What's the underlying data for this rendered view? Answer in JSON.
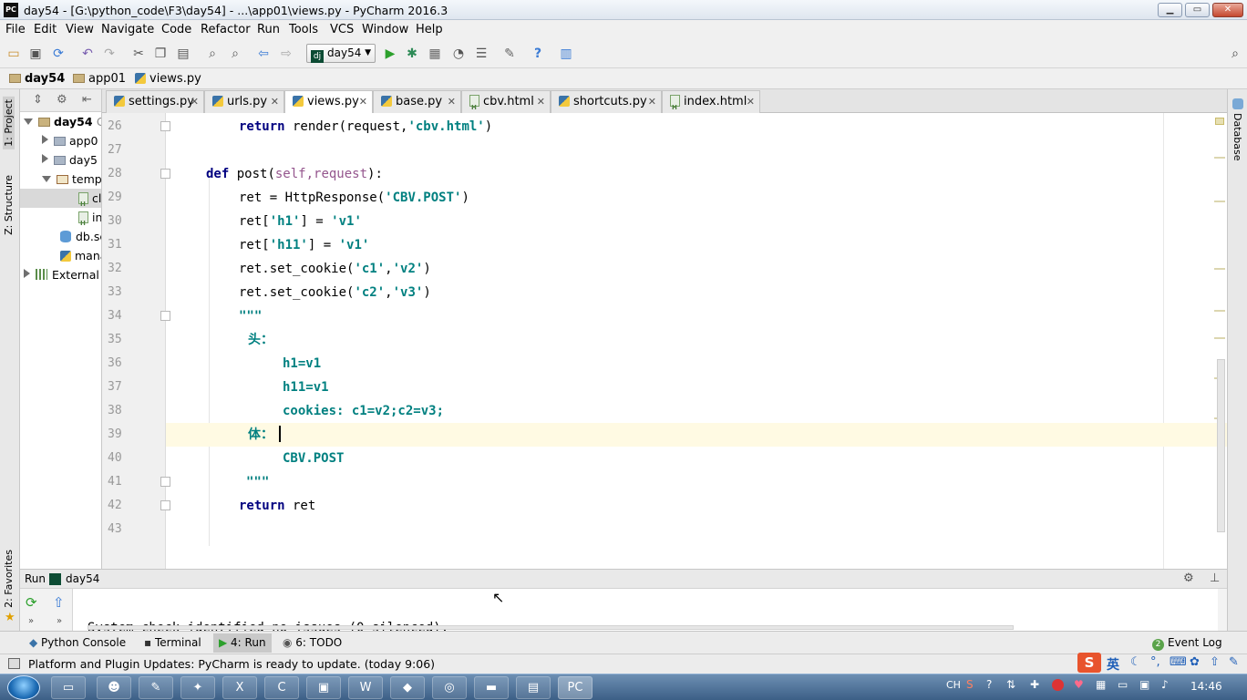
{
  "window": {
    "app_icon_label": "PC",
    "title": "day54 - [G:\\python_code\\F3\\day54] - ...\\app01\\views.py - PyCharm 2016.3",
    "minimize": "▁",
    "maximize": "▭",
    "close": "✕"
  },
  "menu": [
    "File",
    "Edit",
    "View",
    "Navigate",
    "Code",
    "Refactor",
    "Run",
    "Tools",
    "VCS",
    "Window",
    "Help"
  ],
  "toolbar": {
    "run_config": "day54",
    "run_config_icon": "dj"
  },
  "breadcrumb": [
    "day54",
    "app01",
    "views.py"
  ],
  "left_tool_tabs": {
    "project": "1: Project",
    "structure": "Z: Structure",
    "favorites": "2: Favorites"
  },
  "right_tool_tabs": {
    "database": "Database"
  },
  "project_tree": [
    {
      "label": "day54",
      "suffix": "G",
      "expanded": true
    },
    {
      "label": "app0",
      "collapsed": true
    },
    {
      "label": "day5",
      "collapsed": true
    },
    {
      "label": "temp",
      "expanded": true
    },
    {
      "label": "cl",
      "selected": true
    },
    {
      "label": "in"
    },
    {
      "label": "db.sc"
    },
    {
      "label": "mana"
    },
    {
      "label": "External",
      "collapsed": true
    }
  ],
  "tabs": [
    {
      "label": "settings.py",
      "icon": "python-file-icon"
    },
    {
      "label": "urls.py",
      "icon": "python-file-icon"
    },
    {
      "label": "views.py",
      "icon": "python-file-icon",
      "active": true
    },
    {
      "label": "base.py",
      "icon": "python-file-icon"
    },
    {
      "label": "cbv.html",
      "icon": "html-file-icon"
    },
    {
      "label": "shortcuts.py",
      "icon": "python-file-icon"
    },
    {
      "label": "index.html",
      "icon": "html-file-icon"
    }
  ],
  "tab_close": "✕",
  "editor": {
    "line_numbers": [
      "26",
      "27",
      "28",
      "29",
      "30",
      "31",
      "32",
      "33",
      "34",
      "35",
      "36",
      "37",
      "38",
      "39",
      "40",
      "41",
      "42",
      "43"
    ],
    "lines": {
      "l26": {
        "kw": "return",
        "rest": " render(request,",
        "str": "'cbv.html'",
        "end": ")"
      },
      "l28": {
        "kw": "def",
        "name": " post(",
        "par": "self,request",
        "end": "):"
      },
      "l29": {
        "pre": "ret = HttpResponse(",
        "str": "'CBV.POST'",
        "end": ")"
      },
      "l30": {
        "pre": "ret[",
        "str1": "'h1'",
        "mid": "] = ",
        "str2": "'v1'"
      },
      "l31": {
        "pre": "ret[",
        "str1": "'h11'",
        "mid": "] = ",
        "str2": "'v1'"
      },
      "l32": {
        "pre": "ret.set_cookie(",
        "str1": "'c1'",
        "mid": ",",
        "str2": "'v2'",
        "end": ")"
      },
      "l33": {
        "pre": "ret.set_cookie(",
        "str1": "'c2'",
        "mid": ",",
        "str2": "'v3'",
        "end": ")"
      },
      "l34": "\"\"\"",
      "l35": "头：",
      "l36": "h1=v1",
      "l37": "h11=v1",
      "l38": "cookies: c1=v2;c2=v3;",
      "l39": "体：",
      "l40": "CBV.POST",
      "l41": "\"\"\"",
      "l42": {
        "kw": "return",
        "rest": " ret"
      }
    },
    "current_line": "39"
  },
  "run_panel": {
    "label": "Run",
    "config": "day54",
    "console_output": "System check identified no issues (0 silenced)."
  },
  "tool_tabs": [
    {
      "label": "Python Console"
    },
    {
      "label": "Terminal"
    },
    {
      "label": "4: Run",
      "active": true
    },
    {
      "label": "6: TODO"
    }
  ],
  "event_log": {
    "badge": "2",
    "label": "Event Log"
  },
  "status": "Platform and Plugin Updates: PyCharm is ready to update. (today 9:06)",
  "ime": {
    "lang": "英",
    "input_lang": "CH"
  },
  "clock": "14:46",
  "colors": {
    "keyword": "#000080",
    "string": "#008080",
    "param": "#94558d",
    "current_line": "#fffae3"
  }
}
